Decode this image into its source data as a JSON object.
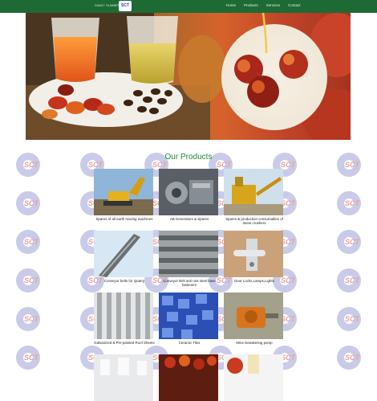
{
  "brand": {
    "name": "SAWIT SUMBERMAS",
    "logo_text": "SCT"
  },
  "nav": [
    "Home",
    "Products",
    "Services",
    "Contact"
  ],
  "watermark_text": "SCT",
  "section_title": "Our Products",
  "products": [
    {
      "label": "Spares of all earth moving machines"
    },
    {
      "label": "AB Generators & Spares"
    },
    {
      "label": "Spares & production consumables of stone crushers"
    },
    {
      "label": "Conveyor belts for Quarry"
    },
    {
      "label": "Conveyor Belt anti rust steel base fasteners"
    },
    {
      "label": "Door Locks,Lamps,Lights"
    },
    {
      "label": "Galvanized & Pre-painted Roof Sheets"
    },
    {
      "label": "Ceramic Tiles"
    },
    {
      "label": "Mine Dewatering pump"
    },
    {
      "label": ""
    },
    {
      "label": ""
    },
    {
      "label": ""
    }
  ],
  "colors": {
    "topbar": "#1d6a35",
    "title": "#1f8a3a",
    "watermark": "#c9cbe8"
  }
}
